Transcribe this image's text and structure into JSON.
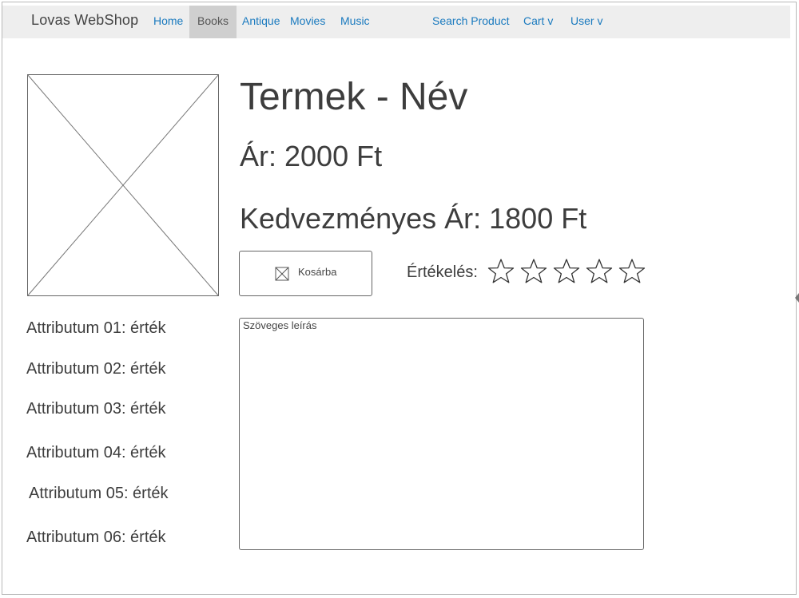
{
  "navbar": {
    "brand": "Lovas WebShop",
    "items": [
      {
        "label": "Home",
        "active": false
      },
      {
        "label": "Books",
        "active": true
      },
      {
        "label": "Antique",
        "active": false
      },
      {
        "label": "Movies",
        "active": false
      },
      {
        "label": "Music",
        "active": false
      },
      {
        "label": "Search Product",
        "active": false
      },
      {
        "label": "Cart v",
        "active": false
      },
      {
        "label": "User v",
        "active": false
      }
    ]
  },
  "product": {
    "title": "Termek - Név",
    "price": "Ár: 2000 Ft",
    "discount_price": "Kedvezményes Ár: 1800 Ft",
    "cart_button_label": "Kosárba",
    "rating_label": "Értékelés:",
    "rating_max": 5,
    "rating_value": 0,
    "description": "Szöveges leírás"
  },
  "attributes": [
    "Attributum 01: érték",
    "Attributum 02: érték",
    "Attributum 03: érték",
    "Attributum 04: érték",
    "Attributum 05: érték",
    "Attributum 06: érték"
  ],
  "colors": {
    "nav_background": "#eeeeee",
    "nav_active_background": "#cfcfcf",
    "link": "#1a7abf",
    "text": "#3d3d3d"
  }
}
